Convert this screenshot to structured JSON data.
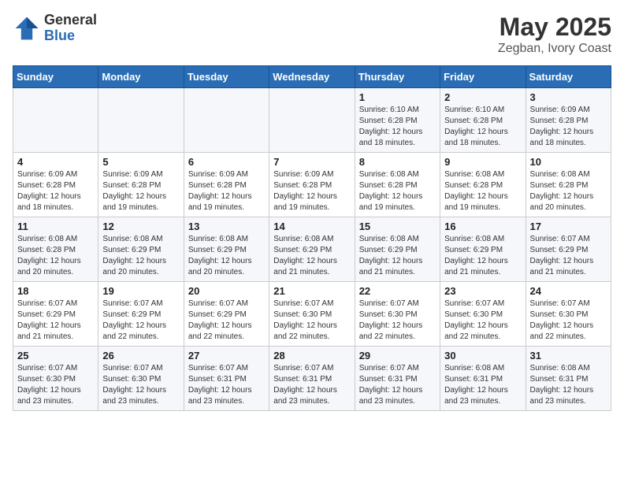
{
  "logo": {
    "general": "General",
    "blue": "Blue"
  },
  "title": "May 2025",
  "location": "Zegban, Ivory Coast",
  "days_of_week": [
    "Sunday",
    "Monday",
    "Tuesday",
    "Wednesday",
    "Thursday",
    "Friday",
    "Saturday"
  ],
  "weeks": [
    [
      {
        "day": "",
        "info": ""
      },
      {
        "day": "",
        "info": ""
      },
      {
        "day": "",
        "info": ""
      },
      {
        "day": "",
        "info": ""
      },
      {
        "day": "1",
        "info": "Sunrise: 6:10 AM\nSunset: 6:28 PM\nDaylight: 12 hours and 18 minutes."
      },
      {
        "day": "2",
        "info": "Sunrise: 6:10 AM\nSunset: 6:28 PM\nDaylight: 12 hours and 18 minutes."
      },
      {
        "day": "3",
        "info": "Sunrise: 6:09 AM\nSunset: 6:28 PM\nDaylight: 12 hours and 18 minutes."
      }
    ],
    [
      {
        "day": "4",
        "info": "Sunrise: 6:09 AM\nSunset: 6:28 PM\nDaylight: 12 hours and 18 minutes."
      },
      {
        "day": "5",
        "info": "Sunrise: 6:09 AM\nSunset: 6:28 PM\nDaylight: 12 hours and 19 minutes."
      },
      {
        "day": "6",
        "info": "Sunrise: 6:09 AM\nSunset: 6:28 PM\nDaylight: 12 hours and 19 minutes."
      },
      {
        "day": "7",
        "info": "Sunrise: 6:09 AM\nSunset: 6:28 PM\nDaylight: 12 hours and 19 minutes."
      },
      {
        "day": "8",
        "info": "Sunrise: 6:08 AM\nSunset: 6:28 PM\nDaylight: 12 hours and 19 minutes."
      },
      {
        "day": "9",
        "info": "Sunrise: 6:08 AM\nSunset: 6:28 PM\nDaylight: 12 hours and 19 minutes."
      },
      {
        "day": "10",
        "info": "Sunrise: 6:08 AM\nSunset: 6:28 PM\nDaylight: 12 hours and 20 minutes."
      }
    ],
    [
      {
        "day": "11",
        "info": "Sunrise: 6:08 AM\nSunset: 6:28 PM\nDaylight: 12 hours and 20 minutes."
      },
      {
        "day": "12",
        "info": "Sunrise: 6:08 AM\nSunset: 6:29 PM\nDaylight: 12 hours and 20 minutes."
      },
      {
        "day": "13",
        "info": "Sunrise: 6:08 AM\nSunset: 6:29 PM\nDaylight: 12 hours and 20 minutes."
      },
      {
        "day": "14",
        "info": "Sunrise: 6:08 AM\nSunset: 6:29 PM\nDaylight: 12 hours and 21 minutes."
      },
      {
        "day": "15",
        "info": "Sunrise: 6:08 AM\nSunset: 6:29 PM\nDaylight: 12 hours and 21 minutes."
      },
      {
        "day": "16",
        "info": "Sunrise: 6:08 AM\nSunset: 6:29 PM\nDaylight: 12 hours and 21 minutes."
      },
      {
        "day": "17",
        "info": "Sunrise: 6:07 AM\nSunset: 6:29 PM\nDaylight: 12 hours and 21 minutes."
      }
    ],
    [
      {
        "day": "18",
        "info": "Sunrise: 6:07 AM\nSunset: 6:29 PM\nDaylight: 12 hours and 21 minutes."
      },
      {
        "day": "19",
        "info": "Sunrise: 6:07 AM\nSunset: 6:29 PM\nDaylight: 12 hours and 22 minutes."
      },
      {
        "day": "20",
        "info": "Sunrise: 6:07 AM\nSunset: 6:29 PM\nDaylight: 12 hours and 22 minutes."
      },
      {
        "day": "21",
        "info": "Sunrise: 6:07 AM\nSunset: 6:30 PM\nDaylight: 12 hours and 22 minutes."
      },
      {
        "day": "22",
        "info": "Sunrise: 6:07 AM\nSunset: 6:30 PM\nDaylight: 12 hours and 22 minutes."
      },
      {
        "day": "23",
        "info": "Sunrise: 6:07 AM\nSunset: 6:30 PM\nDaylight: 12 hours and 22 minutes."
      },
      {
        "day": "24",
        "info": "Sunrise: 6:07 AM\nSunset: 6:30 PM\nDaylight: 12 hours and 22 minutes."
      }
    ],
    [
      {
        "day": "25",
        "info": "Sunrise: 6:07 AM\nSunset: 6:30 PM\nDaylight: 12 hours and 23 minutes."
      },
      {
        "day": "26",
        "info": "Sunrise: 6:07 AM\nSunset: 6:30 PM\nDaylight: 12 hours and 23 minutes."
      },
      {
        "day": "27",
        "info": "Sunrise: 6:07 AM\nSunset: 6:31 PM\nDaylight: 12 hours and 23 minutes."
      },
      {
        "day": "28",
        "info": "Sunrise: 6:07 AM\nSunset: 6:31 PM\nDaylight: 12 hours and 23 minutes."
      },
      {
        "day": "29",
        "info": "Sunrise: 6:07 AM\nSunset: 6:31 PM\nDaylight: 12 hours and 23 minutes."
      },
      {
        "day": "30",
        "info": "Sunrise: 6:08 AM\nSunset: 6:31 PM\nDaylight: 12 hours and 23 minutes."
      },
      {
        "day": "31",
        "info": "Sunrise: 6:08 AM\nSunset: 6:31 PM\nDaylight: 12 hours and 23 minutes."
      }
    ]
  ]
}
